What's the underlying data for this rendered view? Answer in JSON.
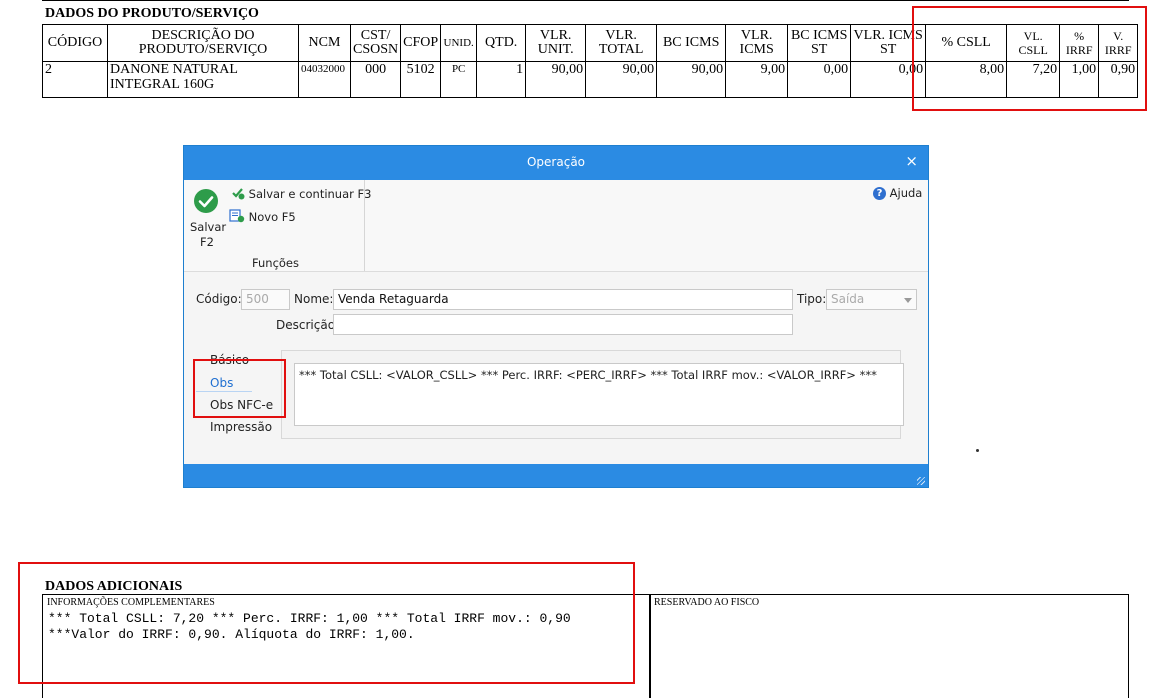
{
  "product_section": {
    "title": "DADOS DO PRODUTO/SERVIÇO",
    "headers": {
      "codigo": "CÓDIGO",
      "descricao_1": "DESCRIÇÃO DO",
      "descricao_2": "PRODUTO/SERVIÇO",
      "ncm": "NCM",
      "cst_1": "CST/",
      "cst_2": "CSOSN",
      "cfop": "CFOP",
      "unid": "UNID.",
      "qtd": "QTD.",
      "vlr_unit_1": "VLR.",
      "vlr_unit_2": "UNIT.",
      "vlr_total_1": "VLR.",
      "vlr_total_2": "TOTAL",
      "bc_icms": "BC ICMS",
      "vlr_icms_1": "VLR.",
      "vlr_icms_2": "ICMS",
      "bc_icms_st_1": "BC ICMS",
      "bc_icms_st_2": "ST",
      "vlr_icms_st_1": "VLR. ICMS",
      "vlr_icms_st_2": "ST",
      "perc_csll": "% CSLL",
      "vl_csll_1": "VL.",
      "vl_csll_2": "CSLL",
      "perc_irrf_1": "%",
      "perc_irrf_2": "IRRF",
      "v_irrf_1": "V.",
      "v_irrf_2": "IRRF"
    },
    "row": {
      "codigo": "2",
      "descricao_1": "DANONE NATURAL",
      "descricao_2": "INTEGRAL 160G",
      "ncm": "04032000",
      "cst": "000",
      "cfop": "5102",
      "unid": "PC",
      "qtd": "1",
      "vlr_unit": "90,00",
      "vlr_total": "90,00",
      "bc_icms": "90,00",
      "vlr_icms": "9,00",
      "bc_icms_st": "0,00",
      "vlr_icms_st": "0,00",
      "perc_csll": "8,00",
      "vl_csll": "7,20",
      "perc_irrf": "1,00",
      "v_irrf": "0,90"
    }
  },
  "dialog": {
    "title": "Operação",
    "close_glyph": "×",
    "ribbon": {
      "save_label_1": "Salvar",
      "save_label_2": "F2",
      "save_continue": "Salvar e continuar F3",
      "new": "Novo F5",
      "group_label": "Funções",
      "help": "Ajuda"
    },
    "fields": {
      "codigo_label": "Código:",
      "codigo_value": "500",
      "nome_label": "Nome:",
      "nome_value": "Venda Retaguarda",
      "tipo_label": "Tipo:",
      "tipo_value": "Saída",
      "descricao_label": "Descrição:",
      "descricao_value": ""
    },
    "tabs": [
      "Básico",
      "Obs",
      "Obs NFC-e",
      "Impressão"
    ],
    "active_tab": "Obs",
    "obs_text": "*** Total CSLL: <VALOR_CSLL> *** Perc. IRRF: <PERC_IRRF> *** Total IRRF mov.: <VALOR_IRRF> ***"
  },
  "additional_section": {
    "title": "DADOS ADICIONAIS",
    "info_label": "INFORMAÇÕES COMPLEMENTARES",
    "info_line_1": "*** Total CSLL: 7,20 *** Perc. IRRF: 1,00 *** Total IRRF mov.: 0,90",
    "info_line_2": "***Valor do IRRF: 0,90. Alíquota do IRRF: 1,00.",
    "reserved_label": "RESERVADO AO FISCO"
  },
  "colors": {
    "highlight_red": "#e10f0f",
    "dialog_blue": "#2b8be3",
    "active_tab_blue": "#1f6fd1",
    "save_green": "#2e9c4a"
  },
  "icons": [
    "check-circle-icon",
    "save-continue-icon",
    "new-doc-icon",
    "help-icon",
    "close-icon",
    "dropdown-arrow-icon"
  ]
}
